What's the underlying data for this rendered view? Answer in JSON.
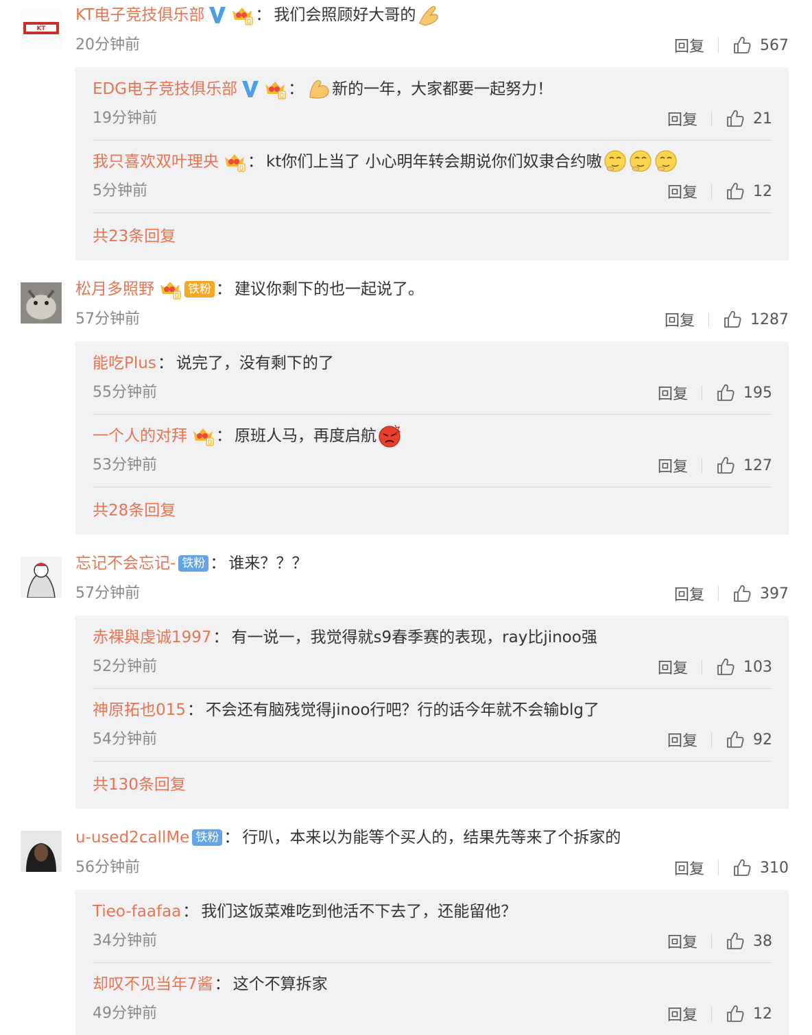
{
  "labels": {
    "reply": "回复"
  },
  "colors": {
    "username": "#eb7350",
    "fan_badge": "#64a4e6",
    "sub_bg": "#f2f2f5"
  },
  "comments": [
    {
      "user": "KT电子竞技俱乐部",
      "colon": "：",
      "badges": [
        "verified-v-icon",
        "vip-crown-icon"
      ],
      "text": "我们会照顾好大哥的",
      "emoji": "praying-hands-emoji",
      "time": "20分钟前",
      "likes": "567",
      "replies": [
        {
          "user": "EDG电子竞技俱乐部",
          "colon": "：",
          "badges": [
            "verified-v-icon",
            "vip-crown-icon"
          ],
          "emoji_before": "strong-arm-emoji",
          "text": "新的一年，大家都要一起努力！",
          "time": "19分钟前",
          "likes": "21"
        },
        {
          "user": "我只喜欢双叶理央",
          "colon": "：",
          "badges": [
            "vip-crown-icon"
          ],
          "text": "kt你们上当了 小心明年转会期说你们奴隶合约嗷",
          "emoji": "thinking-face-emoji x3",
          "time": "5分钟前",
          "likes": "12"
        }
      ],
      "more": "共23条回复"
    },
    {
      "user": "松月多照野",
      "colon": "：",
      "badges": [
        "vip-crown-icon",
        "iron-fan-badge"
      ],
      "fan_badge": "铁粉",
      "text": "建议你剩下的也一起说了。",
      "time": "57分钟前",
      "likes": "1287",
      "replies": [
        {
          "user": "能吃Plus",
          "colon": "：",
          "text": "说完了，没有剩下的了",
          "time": "55分钟前",
          "likes": "195"
        },
        {
          "user": "一个人的对拜",
          "colon": "：",
          "badges": [
            "vip-crown-icon"
          ],
          "text": "原班人马，再度启航",
          "emoji": "angry-face-emoji",
          "time": "53分钟前",
          "likes": "127"
        }
      ],
      "more": "共28条回复"
    },
    {
      "user": "忘记不会忘记-",
      "colon": "：",
      "fan_badge": "铁粉",
      "text": "谁来？？？",
      "time": "57分钟前",
      "likes": "397",
      "replies": [
        {
          "user": "赤裸與虔诚1997",
          "colon": "：",
          "text": "有一说一，我觉得就s9春季赛的表现，ray比jinoo强",
          "time": "52分钟前",
          "likes": "103"
        },
        {
          "user": "神原拓也015",
          "colon": "：",
          "text": "不会还有脑残觉得jinoo行吧？行的话今年就不会输blg了",
          "time": "54分钟前",
          "likes": "92"
        }
      ],
      "more": "共130条回复"
    },
    {
      "user": "u-used2callMe",
      "colon": "：",
      "fan_badge": "铁粉",
      "text": "行叭，本来以为能等个买人的，结果先等来了个拆家的",
      "time": "56分钟前",
      "likes": "310",
      "replies": [
        {
          "user": "Tieo-faafaa",
          "colon": "：",
          "text": "我们这饭菜难吃到他活不下去了，还能留他？",
          "time": "34分钟前",
          "likes": "38"
        },
        {
          "user": "却叹不见当年7酱",
          "colon": "：",
          "text": "这个不算拆家",
          "time": "49分钟前",
          "likes": "12"
        }
      ]
    }
  ]
}
